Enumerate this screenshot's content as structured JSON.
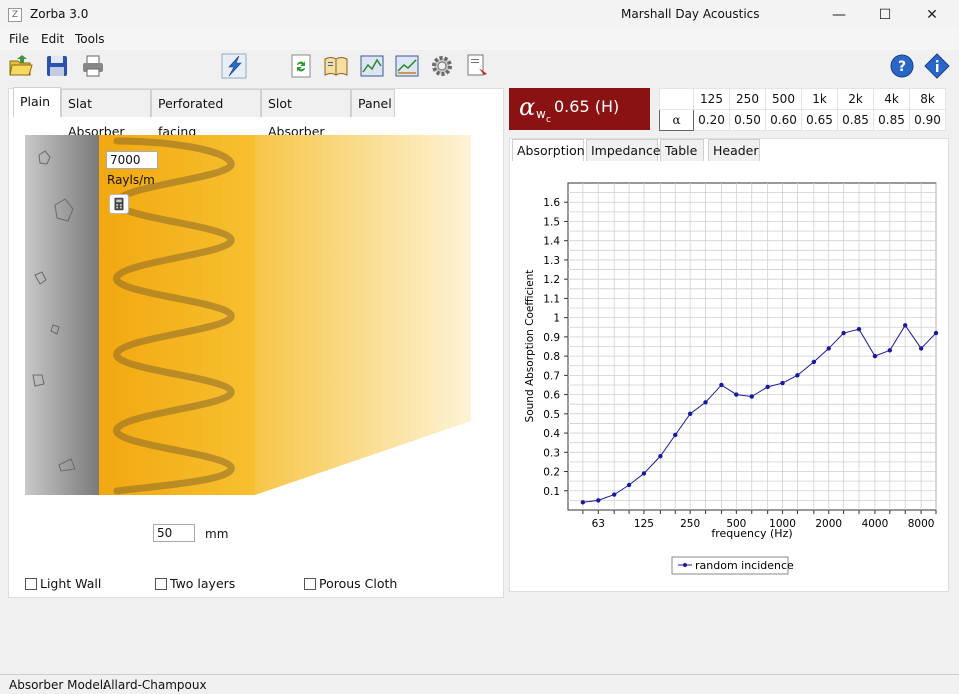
{
  "window": {
    "app_title": "Zorba   3.0",
    "company": "Marshall Day Acoustics",
    "minimize": "—",
    "maximize": "☐",
    "close": "✕"
  },
  "menu": {
    "items": [
      "File",
      "Edit",
      "Tools"
    ]
  },
  "tabs": [
    "Plain",
    "Slat Absorber",
    "Perforated facing",
    "Slot Absorber",
    "Panel"
  ],
  "absorber": {
    "flow_resistivity": "7000",
    "flow_unit": "Rayls/m",
    "thickness": "50",
    "thickness_unit": "mm"
  },
  "options": [
    "Light Wall",
    "Two layers",
    "Porous Cloth"
  ],
  "rating": {
    "symbol": "α",
    "sub": "w",
    "subsub": "c",
    "value": "0.65 (H)"
  },
  "freq_table": {
    "headers": [
      "",
      "125",
      "250",
      "500",
      "1k",
      "2k",
      "4k",
      "8k"
    ],
    "row_label": "α",
    "values": [
      "0.20",
      "0.50",
      "0.60",
      "0.65",
      "0.85",
      "0.85",
      "0.90"
    ]
  },
  "right_tabs": [
    "Absorption",
    "Impedance",
    "Table",
    "Header"
  ],
  "chart_data": {
    "type": "line",
    "ylabel": "Sound Absorption Coefficient",
    "xlabel": "frequency (Hz)",
    "x_scale": "log",
    "xlim": [
      40,
      10000
    ],
    "ylim": [
      0,
      1.7
    ],
    "grid": true,
    "yticks": [
      "0.1",
      "0.2",
      "0.3",
      "0.4",
      "0.5",
      "0.6",
      "0.7",
      "0.8",
      "0.9",
      "1",
      "1.1",
      "1.2",
      "1.3",
      "1.4",
      "1.5",
      "1.6"
    ],
    "xticks": [
      "63",
      "125",
      "250",
      "500",
      "1000",
      "2000",
      "4000",
      "8000"
    ],
    "legend_position": "bottom",
    "series": [
      {
        "name": "random incidence",
        "color": "#1a1aa0",
        "x": [
          50,
          63,
          80,
          100,
          125,
          160,
          200,
          250,
          315,
          400,
          500,
          630,
          800,
          1000,
          1250,
          1600,
          2000,
          2500,
          3150,
          4000,
          5000,
          6300,
          8000,
          10000
        ],
        "y": [
          0.04,
          0.05,
          0.08,
          0.13,
          0.19,
          0.28,
          0.39,
          0.5,
          0.56,
          0.65,
          0.6,
          0.59,
          0.64,
          0.66,
          0.7,
          0.77,
          0.84,
          0.92,
          0.94,
          0.8,
          0.83,
          0.96,
          0.84,
          0.92
        ]
      }
    ]
  },
  "status": {
    "label": "Absorber Model:",
    "value": "Allard-Champoux"
  },
  "colors": {
    "rating_bg": "#8b1212",
    "absorber": "#f2b01e",
    "wall": "#9a9a9a"
  }
}
